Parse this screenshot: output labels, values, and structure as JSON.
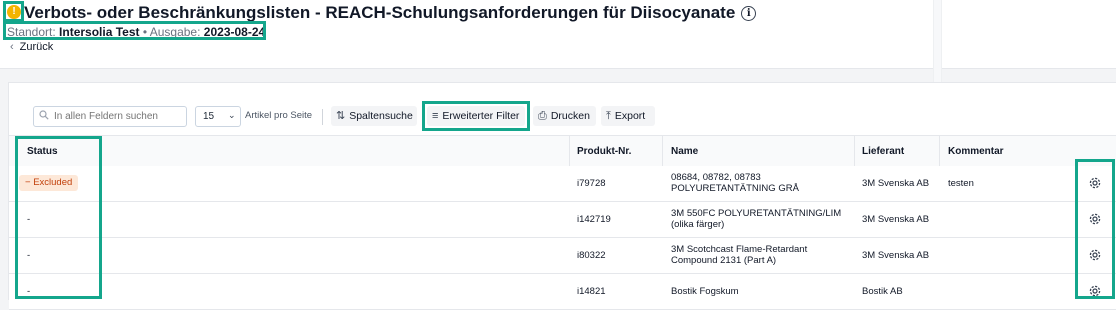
{
  "header": {
    "warning_icon": "warning-circle-icon",
    "title": "Verbots- oder Beschränkungslisten - REACH-Schulungsanforderungen für Diisocyanate",
    "info_icon_glyph": "i",
    "meta": {
      "site_label": "Standort:",
      "site_value": "Intersolia Test",
      "separator": "•",
      "edition_label": "Ausgabe:",
      "edition_value": "2023-08-24"
    },
    "back_label": "Zurück"
  },
  "toolbar": {
    "search_placeholder": "In allen Feldern suchen",
    "page_size": "15",
    "per_page_label": "Artikel pro Seite",
    "column_search_label": "Spaltensuche",
    "advanced_filter_label": "Erweiterter Filter",
    "print_label": "Drucken",
    "export_label": "Export"
  },
  "table": {
    "columns": [
      "Status",
      "Produkt-Nr.",
      "Name",
      "Lieferant",
      "Kommentar"
    ],
    "rows": [
      {
        "status": "Excluded",
        "status_prefix": "−",
        "product_no": "i79728",
        "name": "08684, 08782, 08783 POLYURETANTÄTNING GRÅ",
        "supplier": "3M Svenska AB",
        "comment": "testen"
      },
      {
        "status": "-",
        "product_no": "i142719",
        "name": "3M 550FC POLYURETANTÄTNING/LIM (olika färger)",
        "supplier": "3M Svenska AB",
        "comment": ""
      },
      {
        "status": "-",
        "product_no": "i80322",
        "name": "3M Scotchcast Flame-Retardant Compound 2131 (Part A)",
        "supplier": "3M Svenska AB",
        "comment": ""
      },
      {
        "status": "-",
        "product_no": "i14821",
        "name": "Bostik Fogskum",
        "supplier": "Bostik AB",
        "comment": ""
      }
    ]
  },
  "colors": {
    "highlight": "#14a68c",
    "warning": "#f4b400",
    "badge_bg": "#fde8d8",
    "badge_text": "#c2410c"
  }
}
